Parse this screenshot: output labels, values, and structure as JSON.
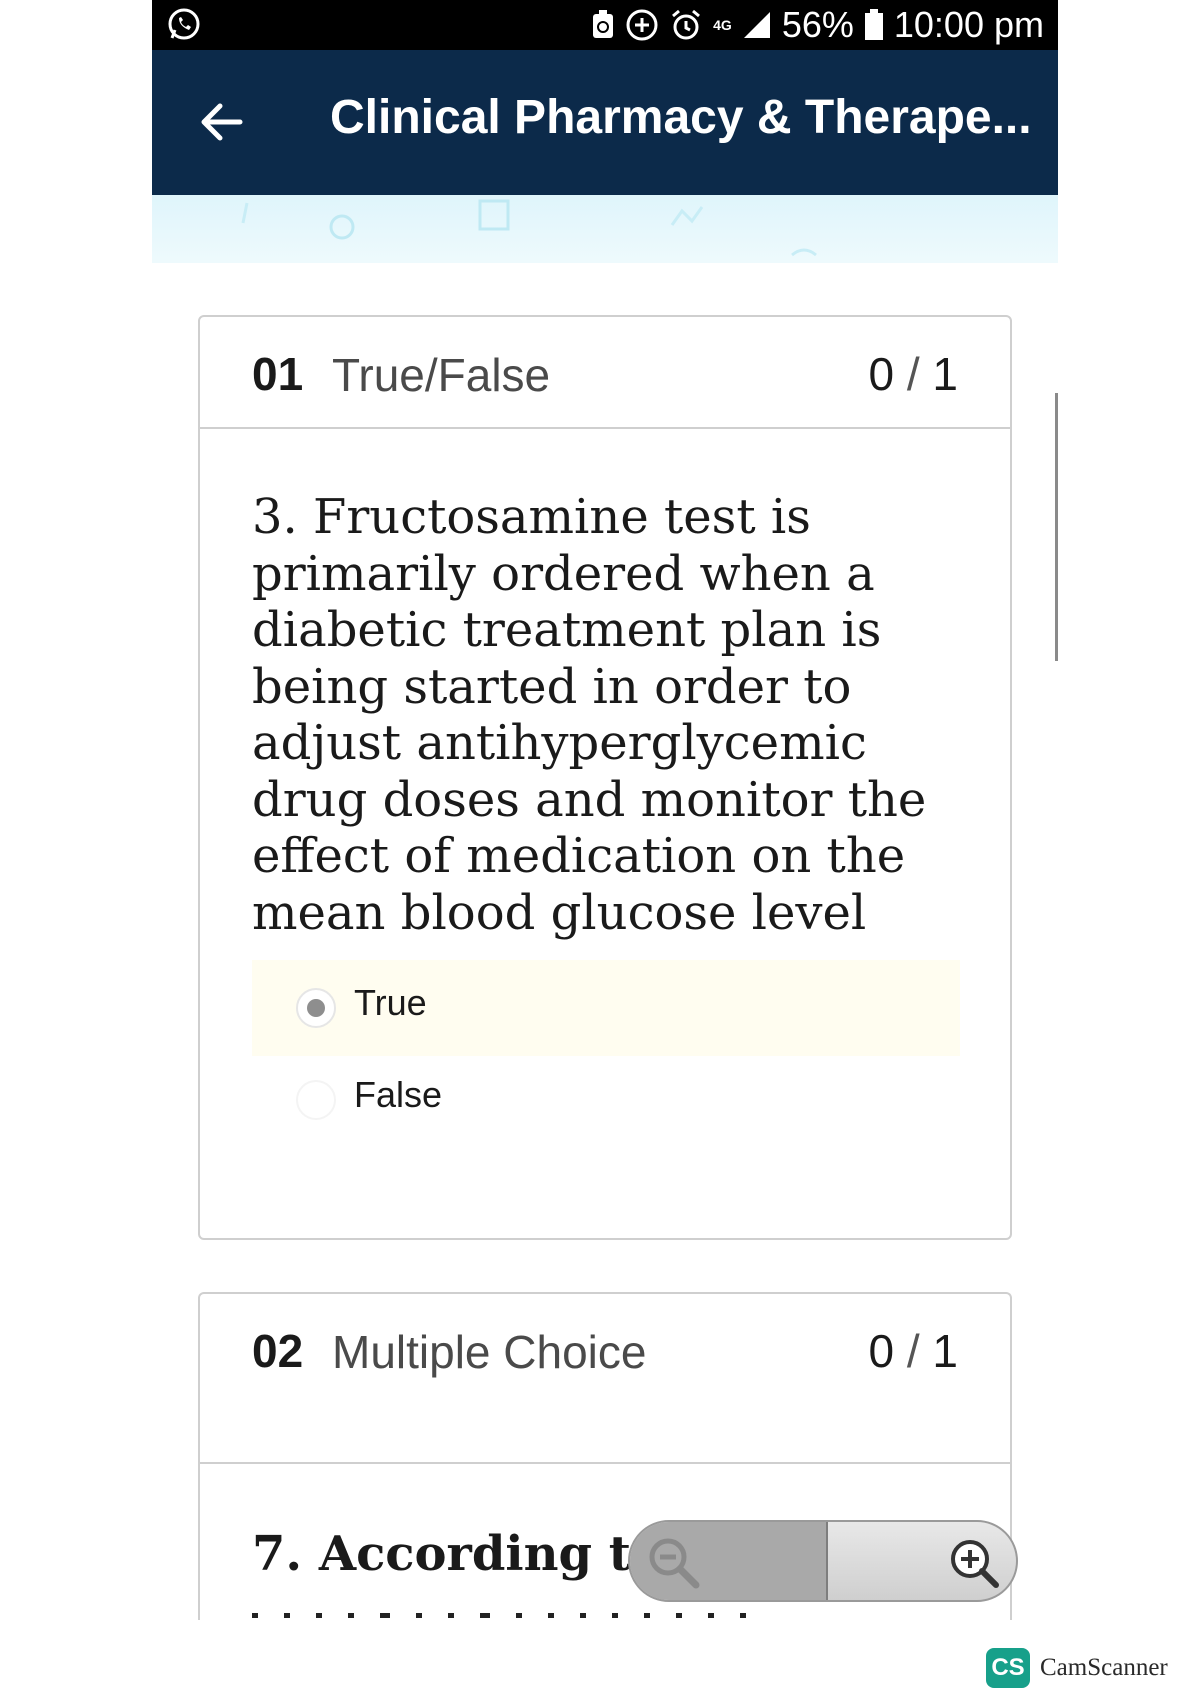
{
  "status_bar": {
    "battery": "56%",
    "time": "10:00 pm",
    "network": "4G",
    "icons": [
      "whatsapp-icon",
      "battery-saver-icon",
      "add-circle-icon",
      "alarm-icon",
      "signal-icon",
      "battery-icon"
    ]
  },
  "header": {
    "title": "Clinical Pharmacy & Therape...",
    "back_icon": "arrow-left-icon",
    "color": "#0c2a4a"
  },
  "questions": [
    {
      "number": "01",
      "type": "True/False",
      "score": "0",
      "score_sep": "/",
      "score_total": "1",
      "text": "3. Fructosamine test is primarily ordered when a diabetic treatment plan is being started in order to adjust antihyperglycemic drug doses and monitor the effect of medication on the mean blood glucose level",
      "options": [
        {
          "label": "True",
          "selected": true
        },
        {
          "label": "False",
          "selected": false
        }
      ]
    },
    {
      "number": "02",
      "type": "Multiple Choice",
      "score": "0",
      "score_sep": "/",
      "score_total": "1",
      "text": "7. According to"
    }
  ],
  "zoom_control": {
    "zoom_out_icon": "zoom-out-icon",
    "zoom_in_icon": "zoom-in-icon"
  },
  "watermark": {
    "logo": "CS",
    "name": "CamScanner",
    "color": "#17a08a"
  }
}
